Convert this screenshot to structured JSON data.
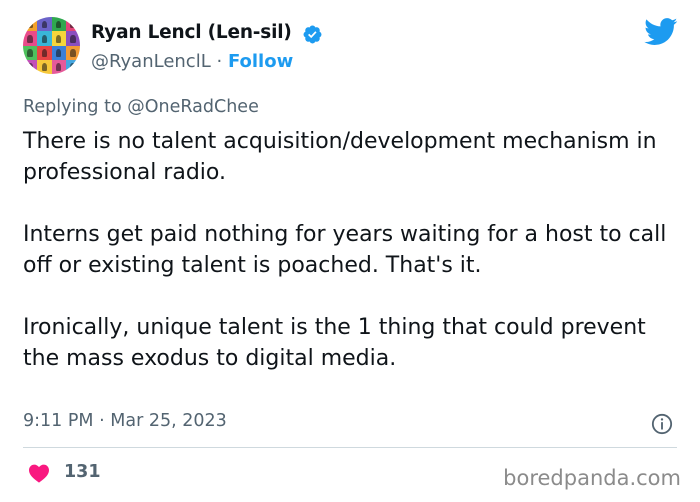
{
  "author": {
    "display_name": "Ryan Lencl (Len-sil)",
    "handle": "@RyanLenclL",
    "separator": "·",
    "follow_label": "Follow",
    "verified": true
  },
  "reply": {
    "prefix": "Replying to",
    "target": "@OneRadChee"
  },
  "tweet": {
    "text": "There is no talent acquisition/development mechanism in professional radio.\n\nInterns get paid nothing for years waiting for a host to call off or existing talent is poached. That's it.\n\nIronically, unique talent is the 1 thing that could prevent the mass exodus to digital media.",
    "time": "9:11 PM",
    "date_separator": "·",
    "date": "Mar 25, 2023"
  },
  "engagement": {
    "likes": "131"
  },
  "watermark": "boredpanda.com",
  "icons": {
    "verified": "verified-badge-icon",
    "platform": "twitter-bird-icon",
    "info": "info-icon",
    "like": "heart-icon"
  },
  "colors": {
    "accent": "#1d9bf0",
    "secondary_text": "#536471",
    "like": "#f91880",
    "avatar_tiles": [
      "#f3a22b",
      "#6b63c9",
      "#2fa84f",
      "#e2437a",
      "#e94b8a",
      "#39b6d8",
      "#f6d53b",
      "#8a4fbf",
      "#4fc15d",
      "#e94545",
      "#3b7fd9",
      "#f29a36",
      "#c24fb8",
      "#f6c83a",
      "#e55a9a",
      "#45a7e0"
    ]
  }
}
